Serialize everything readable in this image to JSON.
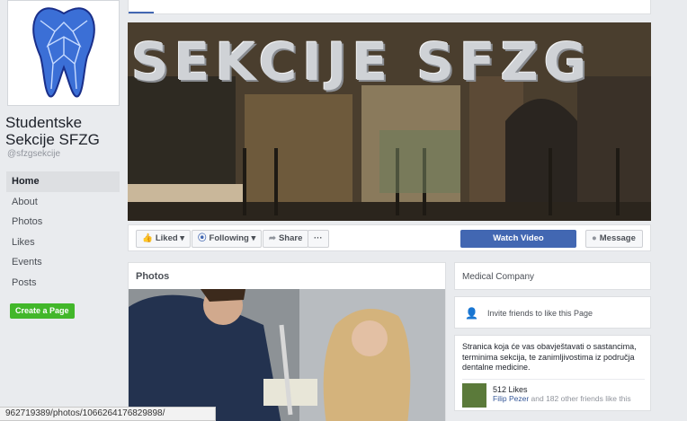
{
  "page": {
    "name": "Studentske Sekcije SFZG",
    "handle": "@sfzgsekcije"
  },
  "nav": {
    "items": [
      "Home",
      "About",
      "Photos",
      "Likes",
      "Events",
      "Posts"
    ],
    "create_page": "Create a Page"
  },
  "cover": {
    "text": "SEKCIJE SFZG"
  },
  "actions": {
    "liked": "Liked",
    "following": "Following",
    "share": "Share",
    "more": "···",
    "watch_video": "Watch Video",
    "message": "Message"
  },
  "photos": {
    "title": "Photos"
  },
  "sidebar": {
    "category": "Medical Company",
    "invite": "Invite friends to like this Page",
    "about": "Stranica koja će vas obavještavati o sastancima, terminima sekcija, te zanimljivostima iz područja dentalne medicine.",
    "likes_count": "512 Likes",
    "friend_name": "Filip Pezer",
    "friends_suffix": "and 182 other friends like this"
  },
  "statusbar": {
    "url": "962719389/photos/1066264176829898/"
  },
  "colors": {
    "brand_blue": "#4267b2",
    "create_green": "#42b72a",
    "background": "#e9ebee"
  }
}
